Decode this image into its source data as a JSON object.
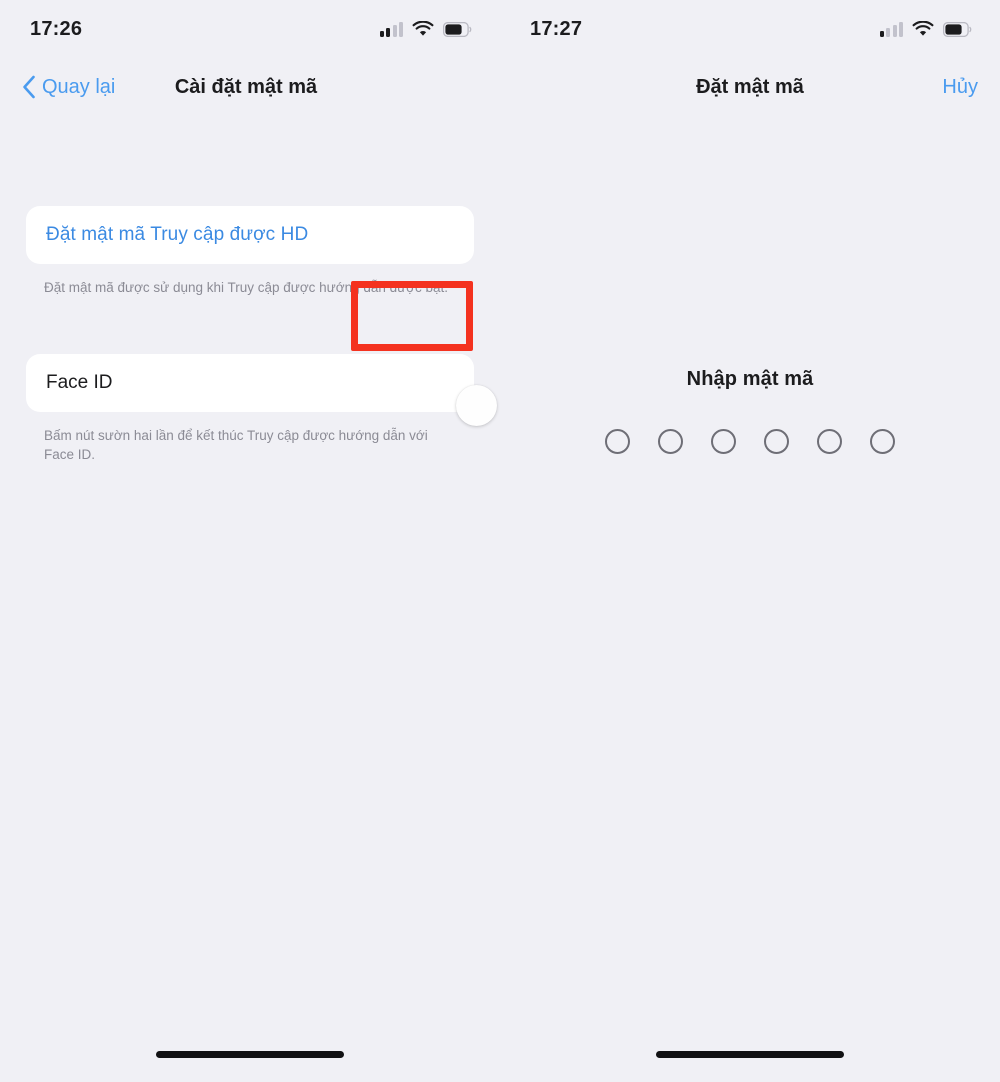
{
  "left_screen": {
    "status_bar": {
      "time": "17:26",
      "signal_icon": "cellular-signal-icon",
      "signal_bars_filled": 2,
      "signal_bars_total": 4,
      "wifi_icon": "wifi-icon",
      "battery_icon": "battery-icon",
      "battery_level_pct": 75
    },
    "nav": {
      "back_label": "Quay lại",
      "back_icon": "chevron-left-icon",
      "title": "Cài đặt mật mã"
    },
    "rows": [
      {
        "label": "Đặt mật mã Truy cập được HD",
        "style": "blue-action",
        "footnote": "Đặt mật mã được sử dụng khi Truy cập được hướng dẫn được bật."
      },
      {
        "label": "Face ID",
        "style": "plain",
        "toggle_state": "off",
        "footnote": "Bấm nút sườn hai lần để kết thúc Truy cập được hướng dẫn với Face ID."
      }
    ],
    "annotation": {
      "target": "face-id-toggle",
      "color": "#f4321f"
    }
  },
  "right_screen": {
    "status_bar": {
      "time": "17:27",
      "signal_icon": "cellular-signal-icon",
      "signal_bars_filled": 1,
      "signal_bars_total": 4,
      "wifi_icon": "wifi-icon",
      "battery_icon": "battery-icon",
      "battery_level_pct": 75
    },
    "nav": {
      "title": "Đặt mật mã",
      "cancel_label": "Hủy"
    },
    "passcode": {
      "prompt": "Nhập mật mã",
      "digit_count": 6,
      "filled_count": 0
    }
  },
  "theme": {
    "background": "#f0f0f5",
    "card_background": "#ffffff",
    "accent_blue": "#3b8ae2",
    "link_blue": "#4a9bef",
    "text_primary": "#1c1c1e",
    "text_secondary": "#8b8b95",
    "annotation_red": "#f4321f",
    "toggle_off_track": "#dedee3"
  }
}
